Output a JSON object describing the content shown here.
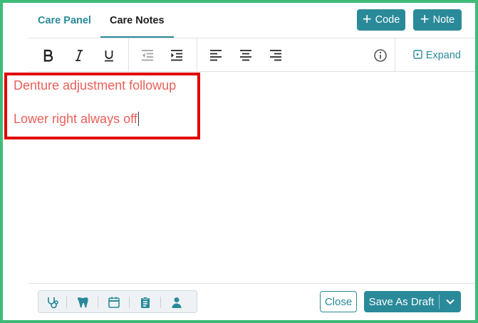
{
  "tabs": [
    {
      "label": "Care Panel",
      "active": false
    },
    {
      "label": "Care Notes",
      "active": true
    }
  ],
  "header_buttons": {
    "code_label": "Code",
    "note_label": "Note"
  },
  "toolbar": {
    "items": [
      "bold-icon",
      "italic-icon",
      "underline-icon",
      "outdent-icon",
      "indent-icon",
      "align-left-icon",
      "align-center-icon",
      "align-right-icon",
      "info-icon"
    ],
    "expand_label": "Expand"
  },
  "editor": {
    "lines": [
      "Denture adjustment followup",
      "Lower right always off"
    ]
  },
  "footer": {
    "icons": [
      "stethoscope-icon",
      "tooth-icon",
      "calendar-icon",
      "clipboard-icon",
      "person-icon"
    ],
    "close_label": "Close",
    "save_label": "Save As Draft"
  },
  "colors": {
    "accent": "#2a8a9a",
    "frame": "#3dbb78",
    "note_text": "#e8605a",
    "highlight": "#e00000"
  }
}
